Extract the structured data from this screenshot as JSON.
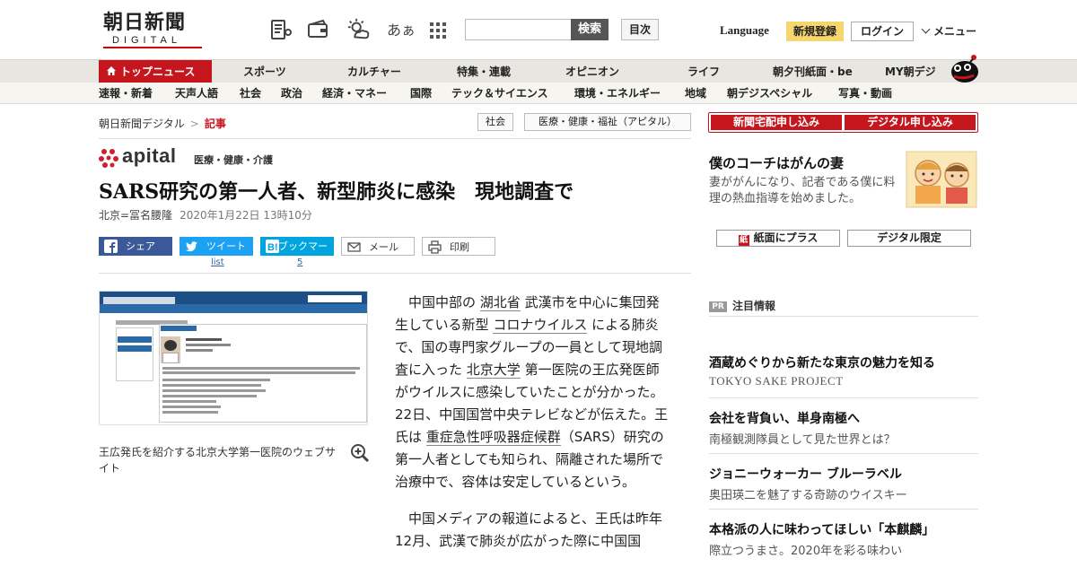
{
  "header": {
    "logo_main": "朝日新聞",
    "logo_sub": "DIGITAL",
    "search_placeholder": "",
    "search_button": "検索",
    "toc_button": "目次",
    "language": "Language",
    "signup": "新規登録",
    "login": "ログイン",
    "menu": "メニュー",
    "font_size_icon_text": "あぁ"
  },
  "nav1": {
    "top": "トップニュース",
    "items": [
      "スポーツ",
      "カルチャー",
      "特集・連載",
      "オピニオン",
      "ライフ",
      "朝夕刊紙面・be",
      "MY朝デジ"
    ]
  },
  "nav2": {
    "items": [
      "速報・新着",
      "天声人語",
      "社会",
      "政治",
      "経済・マネー",
      "国際",
      "テック＆サイエンス",
      "環境・エネルギー",
      "地域",
      "朝デジスペシャル",
      "写真・動画"
    ]
  },
  "breadcrumb": {
    "home": "朝日新聞デジタル",
    "separator": ">",
    "current": "記事"
  },
  "tags": [
    "社会",
    "医療・健康・福祉（アピタル）"
  ],
  "apital": {
    "word": "apital",
    "sub": "医療・健康・介護"
  },
  "article": {
    "title": "SARS研究の第一人者、新型肺炎に感染　現地調査で",
    "author": "北京=冨名腰隆",
    "date": "2020年1月22日 13時10分",
    "caption": "王広発氏を紹介する北京大学第一医院のウェブサイト",
    "p1_a": "中国中部の ",
    "p1_link1": "湖北省",
    "p1_b": " 武漢市を中心に集団発生している新型 ",
    "p1_link2": "コロナウイルス",
    "p1_c": " による肺炎で、国の専門家グループの一員として現地調査に入った ",
    "p1_link3": "北京大学",
    "p1_d": " 第一医院の王広発医師がウイルスに感染していたことが分かった。22日、中国国営中央テレビなどが伝えた。王氏は ",
    "p1_link4": "重症急性呼吸器症候群",
    "p1_e": "（SARS）研究の第一人者としても知られ、隔離された場所で治療中で、容体は安定しているという。",
    "p2": "中国メディアの報道によると、王氏は昨年12月、武漢で肺炎が広がった際に中国国"
  },
  "share": {
    "facebook": "シェア",
    "twitter": "ツイート",
    "hatena": "ブックマーク",
    "mail": "メール",
    "print": "印刷",
    "twitter_count": "list",
    "hatena_count": "5"
  },
  "sidebar": {
    "subscribe_paper": "新聞宅配申し込み",
    "subscribe_digital": "デジタル申し込み",
    "promo_title": "僕のコーチはがんの妻",
    "promo_desc": "妻ががんになり、記者である僕に料理の熱血指導を始めました。",
    "plus_button": "紙面にプラス",
    "digital_only_button": "デジタル限定",
    "pr_badge": "PR",
    "pr_label": "注目情報",
    "ads": [
      {
        "title": "酒蔵めぐりから新たな東京の魅力を知る",
        "sub": "TOKYO SAKE PROJECT"
      },
      {
        "title": "会社を背負い、単身南極へ",
        "sub": "南極観測隊員として見た世界とは？"
      },
      {
        "title": "ジョニーウォーカー ブルーラベル",
        "sub": "奥田瑛二を魅了する奇跡のウイスキー"
      },
      {
        "title": "本格派の人に味わってほしい「本麒麟」",
        "sub": "際立つうまさ。2020年を彩る味わい"
      }
    ]
  },
  "colors": {
    "brand_red": "#c4161c",
    "facebook": "#3b5998",
    "twitter": "#1da1f2",
    "hatena": "#00a4de",
    "signup_yellow": "#f5d76e"
  }
}
